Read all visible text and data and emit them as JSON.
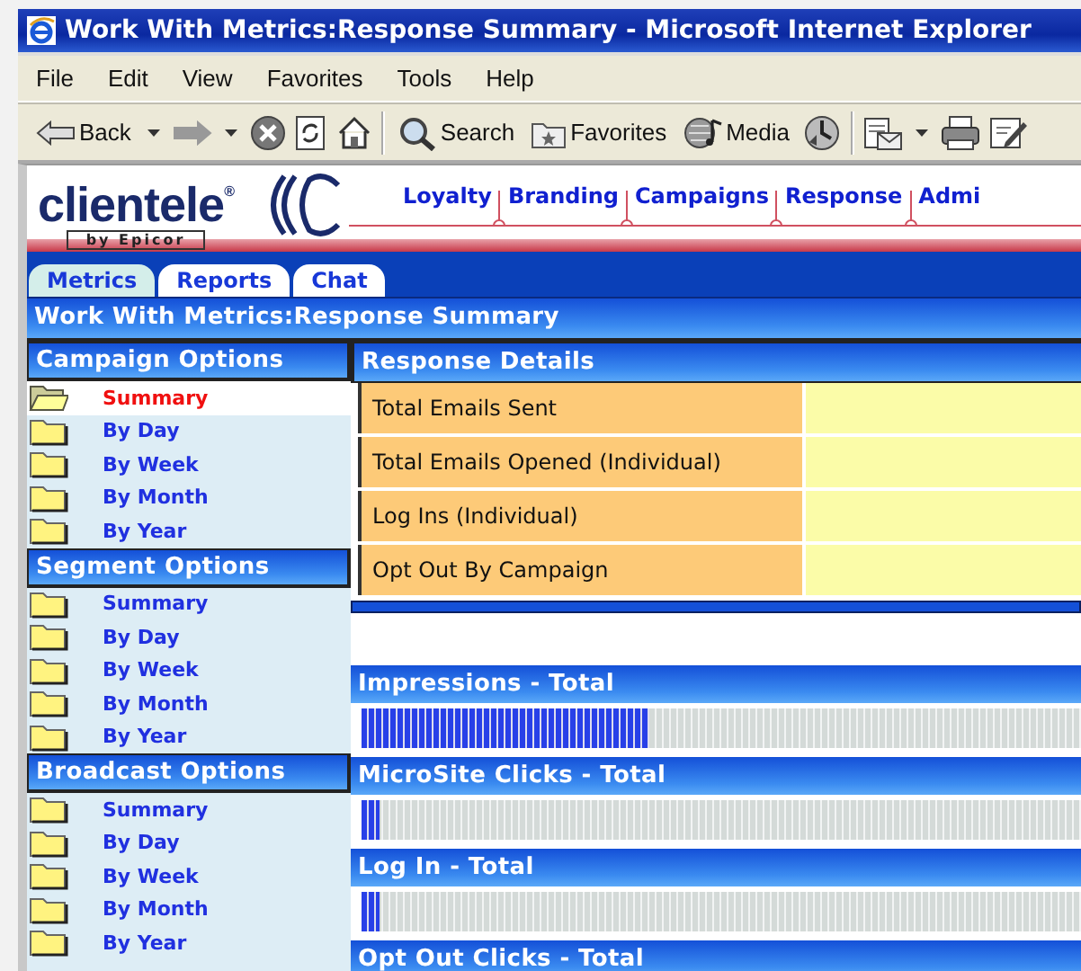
{
  "window": {
    "title": "Work With Metrics:Response Summary - Microsoft Internet Explorer"
  },
  "menu": [
    "File",
    "Edit",
    "View",
    "Favorites",
    "Tools",
    "Help"
  ],
  "toolbar": [
    {
      "kind": "back",
      "label": "Back"
    },
    {
      "kind": "forward"
    },
    {
      "kind": "stop"
    },
    {
      "kind": "refresh"
    },
    {
      "kind": "home"
    },
    {
      "kind": "search",
      "label": "Search"
    },
    {
      "kind": "favorites",
      "label": "Favorites"
    },
    {
      "kind": "media",
      "label": "Media"
    },
    {
      "kind": "history"
    },
    {
      "kind": "mail"
    },
    {
      "kind": "print"
    },
    {
      "kind": "edit"
    }
  ],
  "brand": {
    "name": "clientele$^{®}$",
    "tagline": "by Epicor"
  },
  "nav": [
    "Loyalty",
    "Branding",
    "Campaigns",
    "Response",
    "Admi"
  ],
  "tabs": [
    {
      "label": "Metrics",
      "selected": true
    },
    {
      "label": "Reports",
      "selected": false
    },
    {
      "label": "Chat",
      "selected": false
    }
  ],
  "page_title": "Work With Metrics:Response Summary",
  "sidebar": [
    {
      "title": "Campaign Options",
      "items": [
        {
          "label": "Summary",
          "selected": true
        },
        {
          "label": "By Day",
          "selected": false
        },
        {
          "label": "By Week",
          "selected": false
        },
        {
          "label": "By Month",
          "selected": false
        },
        {
          "label": "By Year",
          "selected": false
        }
      ]
    },
    {
      "title": "Segment Options",
      "items": [
        {
          "label": "Summary",
          "selected": false
        },
        {
          "label": "By Day",
          "selected": false
        },
        {
          "label": "By Week",
          "selected": false
        },
        {
          "label": "By Month",
          "selected": false
        },
        {
          "label": "By Year",
          "selected": false
        }
      ]
    },
    {
      "title": "Broadcast Options",
      "items": [
        {
          "label": "Summary",
          "selected": false
        },
        {
          "label": "By Day",
          "selected": false
        },
        {
          "label": "By Week",
          "selected": false
        },
        {
          "label": "By Month",
          "selected": false
        },
        {
          "label": "By Year",
          "selected": false
        }
      ]
    }
  ],
  "details": {
    "title": "Response Details",
    "rows": [
      "Total Emails Sent",
      "Total Emails Opened (Individual)",
      "Log Ins (Individual)",
      "Opt Out By Campaign"
    ]
  },
  "meters": [
    {
      "title": "Impressions - Total",
      "level": 0.4
    },
    {
      "title": "MicroSite Clicks - Total",
      "level": 0.025
    },
    {
      "title": "Log In - Total",
      "level": 0.025
    },
    {
      "title": "Opt Out Clicks - Total"
    }
  ]
}
